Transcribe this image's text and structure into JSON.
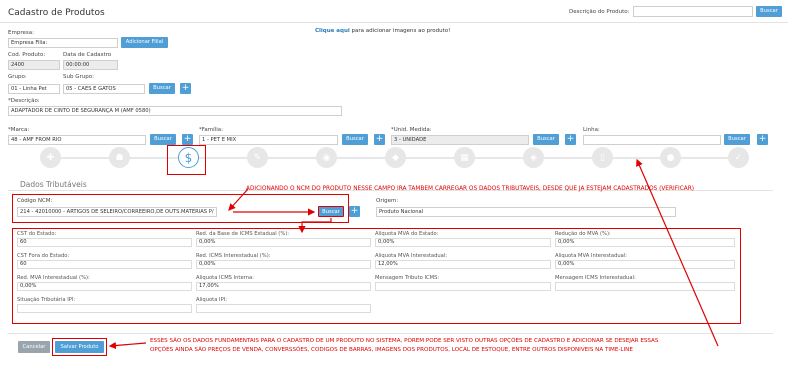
{
  "header": {
    "title": "Cadastro de Produtos",
    "search_label": "Descrição do Produto:",
    "search_value": "",
    "search_button": "Buscar"
  },
  "image_link": {
    "link": "Clique aqui",
    "rest": " para adicionar imagens ao produto!"
  },
  "form": {
    "empresa_label": "Empresa:",
    "empresa_value": "Empresa Filia:",
    "add_filial_button": "Adicionar Filial",
    "cod_label": "Cod. Produto:",
    "cod_value": "2400",
    "data_label": "Data de Cadastro",
    "data_value": "00:00:00",
    "grupo_label": "Grupo:",
    "grupo_value": "01 - Linha Pet",
    "subgrupo_label": "Sub Grupo:",
    "subgrupo_value": "05 - CAES E GATOS",
    "buscar": "Buscar",
    "descricao_label": "*Descrição:",
    "descricao_value": "ADAPTADOR DE CINTO DE SEGURANÇA M (AMF 0580)",
    "marca_label": "*Marca:",
    "marca_value": "48 - AMF FROM RIO",
    "familia_label": "*Família:",
    "familia_value": "1 - PET E MIX",
    "medida_label": "*Unid. Medida:",
    "medida_value": "3 - UNIDADE",
    "linha_label": "Linha:",
    "linha_value": "",
    "plus": "+"
  },
  "timeline": {
    "steps": [
      {
        "icon": "plus-icon",
        "glyph": "✚"
      },
      {
        "icon": "users-icon",
        "glyph": "☗"
      },
      {
        "icon": "dollar-icon",
        "glyph": "$"
      },
      {
        "icon": "wrench-icon",
        "glyph": "✎"
      },
      {
        "icon": "camera-icon",
        "glyph": "◉"
      },
      {
        "icon": "dropbox-icon",
        "glyph": "◆"
      },
      {
        "icon": "barcode-icon",
        "glyph": "▦"
      },
      {
        "icon": "tag-icon",
        "glyph": "◈"
      },
      {
        "icon": "file-icon",
        "glyph": "▯"
      },
      {
        "icon": "map-marker-icon",
        "glyph": "●"
      },
      {
        "icon": "check-icon",
        "glyph": "✓"
      }
    ],
    "active_color": "#4f9fd6"
  },
  "tax": {
    "section_title": "Dados Tributáveis",
    "ncm_label": "Código NCM:",
    "ncm_value": "214 - 42010000 - ARTIGOS DE SELEIRO/CORREEIRO,DE OUTS.MATERIAS P/",
    "buscar": "Buscar",
    "origem_label": "Origem:",
    "origem_value": "Produto Nacional",
    "fields": [
      {
        "label": "CST do Estado:",
        "value": "60"
      },
      {
        "label": "Red. da Base de ICMS Estadual (%):",
        "value": "0,00%"
      },
      {
        "label": "Aliquota MVA do Estado:",
        "value": "0,00%"
      },
      {
        "label": "Redução do MVA (%):",
        "value": "0,00%"
      },
      {
        "label": "CST Fora do Estado:",
        "value": "60"
      },
      {
        "label": "Red. ICMS Interestadual (%):",
        "value": "0,00%"
      },
      {
        "label": "Aliquota MVA Interestadual:",
        "value": "12,00%"
      },
      {
        "label": "Aliquota MVA Interestadual:",
        "value": "0,00%"
      },
      {
        "label": "Red. MVA Interestadual (%):",
        "value": "0,00%"
      },
      {
        "label": "Aliquota ICMS Interna:",
        "value": "17,00%"
      },
      {
        "label": "Mensagem Tributo ICMS:",
        "value": ""
      },
      {
        "label": "Mensagem ICMS Interestadual:",
        "value": ""
      },
      {
        "label": "Situação Tributária IPI:",
        "value": ""
      },
      {
        "label": "Aliquota IPI:",
        "value": ""
      }
    ]
  },
  "actions": {
    "cancel": "Cancelar",
    "save": "Salvar Produto"
  },
  "annotations": {
    "ncm_note": "ADICIONANDO O NCM DO PRODUTO NESSE CAMPO IRA TAMBEM CARREGAR OS DADOS TRIBUTAVEIS, DESDE QUE JA ESTEJAM CADASTRADOS (VERIFICAR)",
    "save_note_1": "ESSES SÃO OS DADOS FUNDAMENTAIS PARA O CADASTRO DE UM PRODUTO NO SISTEMA, POREM PODE SER VISTO OUTRAS OPÇÕES DE CADASTRO E ADICIONAR SE DESEJAR ESSAS",
    "save_note_2": "OPÇÕES AINDA SÃO PREÇOS DE VENDA, CONVERSSÕES, CODIGOS DE BARRAS, IMAGENS DOS PRODUTOS, LOCAL DE ESTOQUE, ENTRE OUTROS DISPONIVEIS NA TIME-LINE",
    "color": "#e00000"
  }
}
